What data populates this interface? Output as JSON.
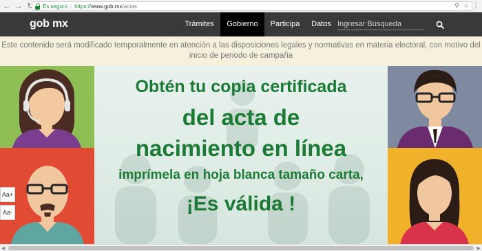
{
  "browser": {
    "secure_label": "Es seguro",
    "url_scheme": "https://",
    "url_host": "www.gob.mx",
    "url_path": "/actas",
    "back_icon": "arrow-left-icon",
    "forward_icon": "arrow-right-icon",
    "reload_icon": "reload-icon"
  },
  "nav": {
    "logo": "gob mx",
    "items": [
      {
        "label": "Trámites"
      },
      {
        "label": "Gobierno"
      },
      {
        "label": "Participa"
      },
      {
        "label": "Datos"
      }
    ],
    "active_item": "Gobierno",
    "search_placeholder": "Ingresar Búsqueda"
  },
  "notice": {
    "text": "Este contenido será modificado temporalmente en atención a las disposiciones legales y normativas en materia electoral, con motivo del inicio de periodo de campaña"
  },
  "banner": {
    "line1": "Obtén tu copia certificada",
    "line2": "del acta de",
    "line3": "nacimiento en línea",
    "line4": "imprímela en hoja blanca tamaño carta,",
    "line5": "¡Es válida !"
  },
  "accessibility": {
    "increase": "Aa+",
    "decrease": "Aa-"
  },
  "colors": {
    "nav_bg": "#393939",
    "notice_bg": "#f6f1dc",
    "banner_text": "#1b7b35",
    "panel_green": "#8fbf54",
    "panel_red": "#e24b33",
    "panel_gray": "#7f8aa0",
    "panel_yellow": "#f2b12b"
  }
}
